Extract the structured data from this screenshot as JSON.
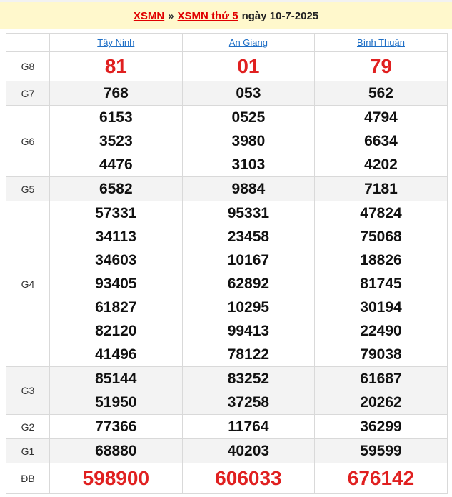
{
  "header": {
    "link1": "XSMN",
    "separator": "»",
    "link2": "XSMN thứ 5",
    "date_text": "ngày 10-7-2025"
  },
  "provinces": [
    "Tây Ninh",
    "An Giang",
    "Bình Thuận"
  ],
  "prizes": [
    {
      "label": "G8",
      "values": [
        [
          "81"
        ],
        [
          "01"
        ],
        [
          "79"
        ]
      ]
    },
    {
      "label": "G7",
      "values": [
        [
          "768"
        ],
        [
          "053"
        ],
        [
          "562"
        ]
      ]
    },
    {
      "label": "G6",
      "values": [
        [
          "6153",
          "3523",
          "4476"
        ],
        [
          "0525",
          "3980",
          "3103"
        ],
        [
          "4794",
          "6634",
          "4202"
        ]
      ]
    },
    {
      "label": "G5",
      "values": [
        [
          "6582"
        ],
        [
          "9884"
        ],
        [
          "7181"
        ]
      ]
    },
    {
      "label": "G4",
      "values": [
        [
          "57331",
          "34113",
          "34603",
          "93405",
          "61827",
          "82120",
          "41496"
        ],
        [
          "95331",
          "23458",
          "10167",
          "62892",
          "10295",
          "99413",
          "78122"
        ],
        [
          "47824",
          "75068",
          "18826",
          "81745",
          "30194",
          "22490",
          "79038"
        ]
      ]
    },
    {
      "label": "G3",
      "values": [
        [
          "85144",
          "51950"
        ],
        [
          "83252",
          "37258"
        ],
        [
          "61687",
          "20262"
        ]
      ]
    },
    {
      "label": "G2",
      "values": [
        [
          "77366"
        ],
        [
          "11764"
        ],
        [
          "36299"
        ]
      ]
    },
    {
      "label": "G1",
      "values": [
        [
          "68880"
        ],
        [
          "40203"
        ],
        [
          "59599"
        ]
      ]
    },
    {
      "label": "ĐB",
      "values": [
        [
          "598900"
        ],
        [
          "606033"
        ],
        [
          "676142"
        ]
      ]
    }
  ],
  "colors": {
    "accent_red": "#e02020",
    "link_blue": "#1f6fc6",
    "header_bg": "#fff8cc"
  }
}
